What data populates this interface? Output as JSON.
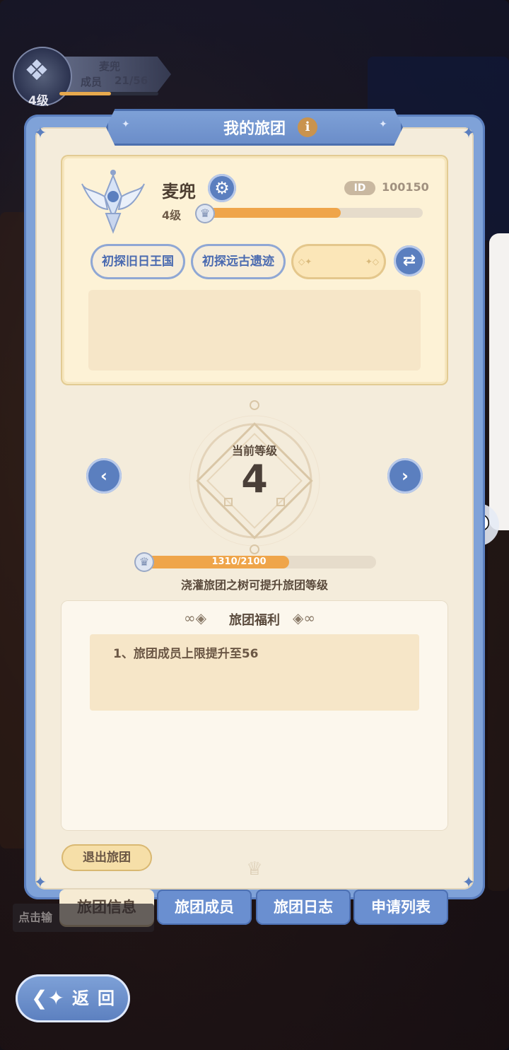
{
  "header": {
    "title": "我的旅团"
  },
  "mini_guild": {
    "name": "麦兜",
    "members_label": "成员",
    "members": "21/56",
    "level": "4级",
    "progress": 0.52
  },
  "guild": {
    "name": "麦兜",
    "id_label": "ID",
    "id": "100150",
    "level": "4级",
    "level_progress": 0.62,
    "tags": [
      "初探旧日王国",
      "初探远古遗迹"
    ]
  },
  "current_level": {
    "label": "当前等级",
    "value": "4"
  },
  "experience": {
    "text": "1310/2100",
    "current": 1310,
    "max": 2100,
    "hint": "浇灌旅团之树可提升旅团等级"
  },
  "benefits": {
    "title": "旅团福利",
    "items": [
      "1、旅团成员上限提升至56"
    ]
  },
  "leave_button": "退出旅团",
  "tabs": [
    {
      "label": "旅团信息",
      "active": true
    },
    {
      "label": "旅团成员",
      "active": false
    },
    {
      "label": "旅团日志",
      "active": false
    },
    {
      "label": "申请列表",
      "active": false
    }
  ],
  "background_hint": "点击输",
  "back_button": "返回",
  "colors": {
    "accent_blue": "#5b7fbf",
    "progress_orange": "#efa54a",
    "panel_cream": "#f4ecdb"
  },
  "icons": [
    "info-icon",
    "gear-icon",
    "swap-icon",
    "chevron-left-icon",
    "chevron-right-icon",
    "crown-icon",
    "chat-icon",
    "back-arrow-icon",
    "guild-emblem-icon"
  ]
}
